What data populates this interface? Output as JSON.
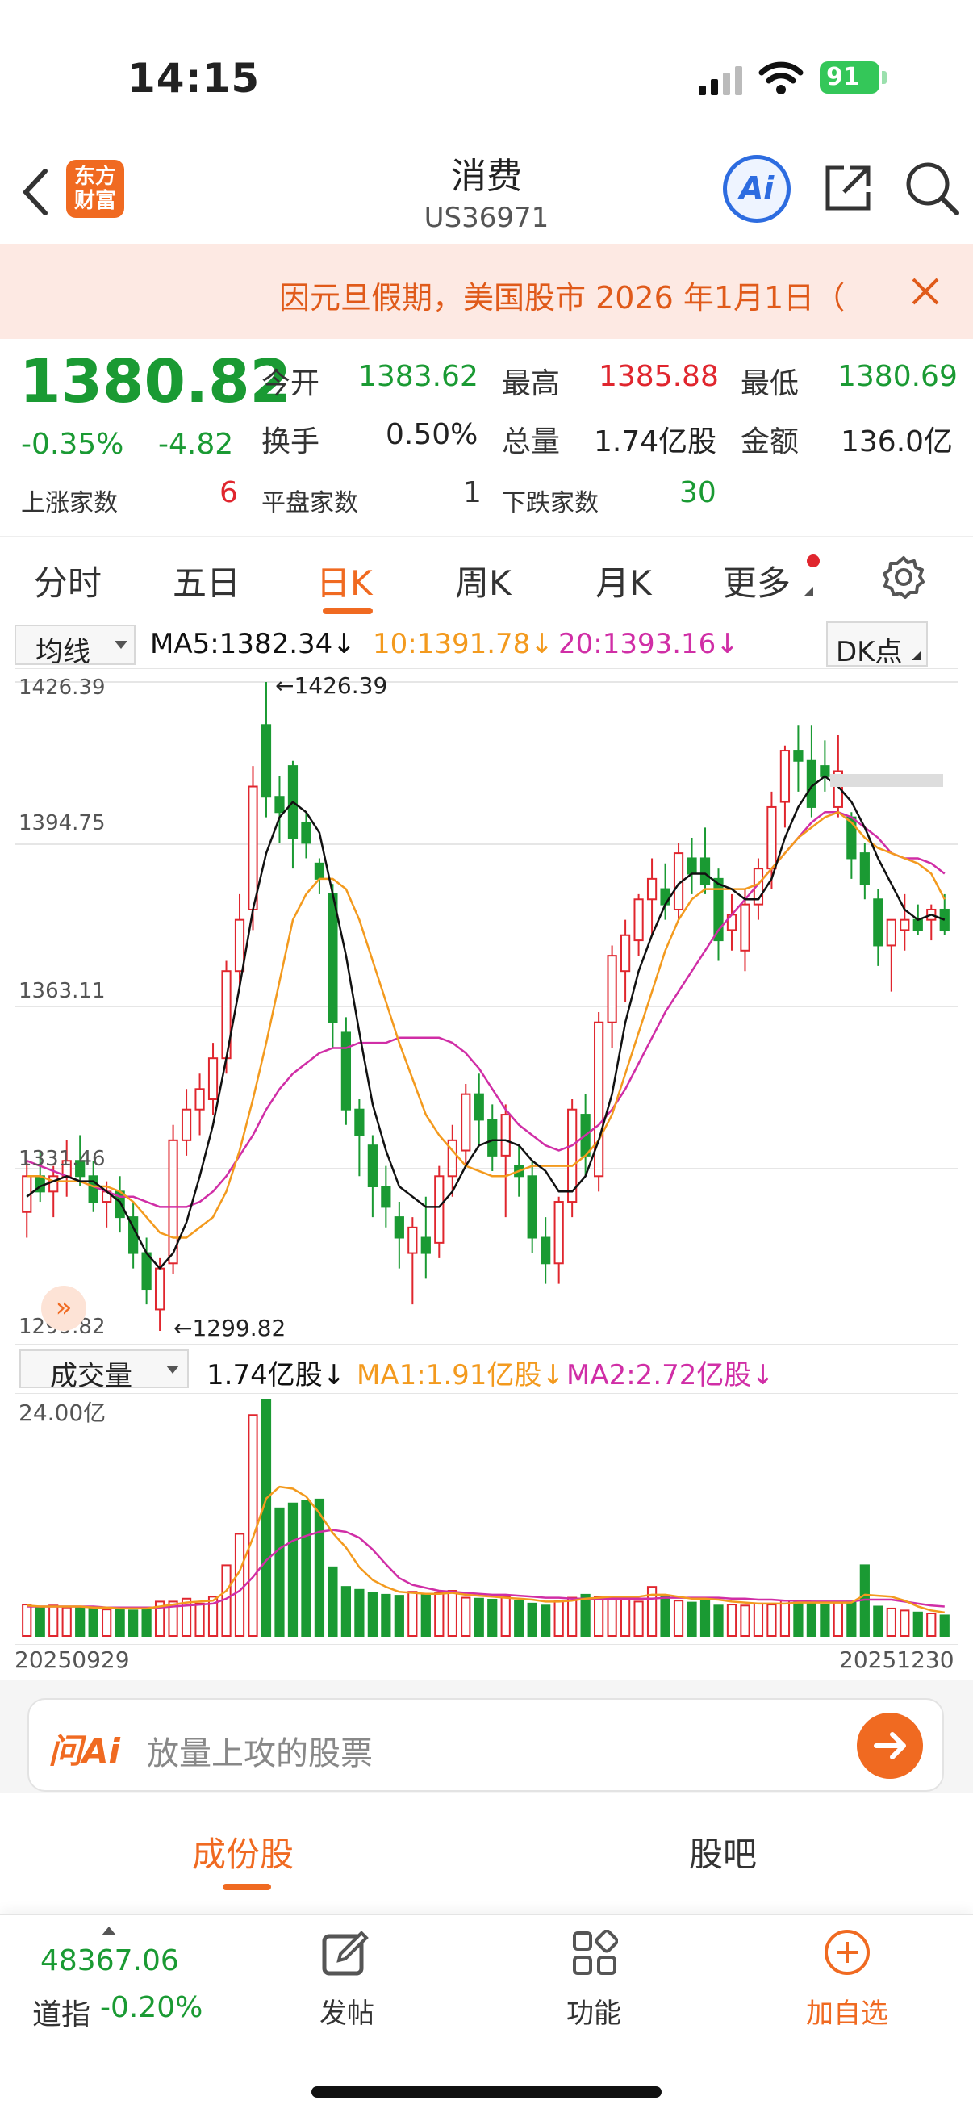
{
  "status_bar": {
    "time": "14:15",
    "battery": "91"
  },
  "nav": {
    "logo_line1": "东方",
    "logo_line2": "财富",
    "title": "消费",
    "subtitle": "US36971",
    "ai_label": "Ai"
  },
  "notice": {
    "text": "因元旦假期，美国股市 2026 年1月1日（"
  },
  "quote": {
    "price": "1380.82",
    "change_pct": "-0.35%",
    "change": "-4.82",
    "open_label": "今开",
    "open": "1383.62",
    "high_label": "最高",
    "high": "1385.88",
    "low_label": "最低",
    "low": "1380.69",
    "turnover_label": "换手",
    "turnover": "0.50%",
    "volume_label": "总量",
    "volume": "1.74亿股",
    "amount_label": "金额",
    "amount": "136.0亿",
    "up_label": "上涨家数",
    "up": "6",
    "flat_label": "平盘家数",
    "flat": "1",
    "down_label": "下跌家数",
    "down": "30"
  },
  "tabs": [
    "分时",
    "五日",
    "日K",
    "周K",
    "月K",
    "更多"
  ],
  "active_tab": "日K",
  "kline_header": {
    "indicator": "均线",
    "ma5": "MA5:1382.34↓",
    "ma10": "10:1391.78↓",
    "ma20": "20:1393.16↓",
    "dk": "DK点"
  },
  "volume_header": {
    "indicator": "成交量",
    "vol": "1.74亿股↓",
    "ma1": "MA1:1.91亿股↓",
    "ma2": "MA2:2.72亿股↓",
    "scale": "24.00亿"
  },
  "dates": {
    "start": "20250929",
    "end": "20251230"
  },
  "colors": {
    "up": "#e0262e",
    "down": "#1a9a33",
    "ma5": "#111111",
    "ma10": "#f39a1e",
    "ma20": "#d02ea6",
    "accent": "#f06a21"
  },
  "chart_data": {
    "type": "candlestick",
    "y_ticks": [
      "1426.39",
      "1394.75",
      "1363.11",
      "1331.46",
      "1299.82"
    ],
    "ylim": [
      1299.82,
      1426.39
    ],
    "annotations": {
      "max": "1426.39",
      "min": "1299.82"
    },
    "x_range": [
      "20250929",
      "20251230"
    ],
    "candles": [
      [
        1323,
        1333,
        1318,
        1330
      ],
      [
        1330,
        1335,
        1325,
        1327
      ],
      [
        1327,
        1332,
        1322,
        1330
      ],
      [
        1330,
        1337,
        1326,
        1333
      ],
      [
        1333,
        1338,
        1328,
        1330
      ],
      [
        1330,
        1333,
        1323,
        1325
      ],
      [
        1325,
        1329,
        1320,
        1327
      ],
      [
        1327,
        1330,
        1319,
        1322
      ],
      [
        1322,
        1325,
        1312,
        1315
      ],
      [
        1315,
        1318,
        1305,
        1308
      ],
      [
        1304,
        1314,
        1299.82,
        1312
      ],
      [
        1313,
        1340,
        1311,
        1337
      ],
      [
        1337,
        1347,
        1334,
        1343
      ],
      [
        1343,
        1350,
        1338,
        1347
      ],
      [
        1345,
        1356,
        1342,
        1353
      ],
      [
        1353,
        1372,
        1350,
        1370
      ],
      [
        1370,
        1385,
        1366,
        1380
      ],
      [
        1382,
        1410,
        1378,
        1406
      ],
      [
        1418,
        1426.39,
        1400,
        1404
      ],
      [
        1404,
        1408,
        1395,
        1401
      ],
      [
        1410,
        1411,
        1390,
        1396
      ],
      [
        1399,
        1401,
        1392,
        1395
      ],
      [
        1391,
        1392,
        1385,
        1388
      ],
      [
        1385,
        1387,
        1355,
        1360
      ],
      [
        1358,
        1361,
        1340,
        1343
      ],
      [
        1343,
        1345,
        1330,
        1338
      ],
      [
        1336,
        1338,
        1322,
        1328
      ],
      [
        1328,
        1332,
        1320,
        1324
      ],
      [
        1322,
        1325,
        1312,
        1318
      ],
      [
        1315,
        1322,
        1305,
        1320
      ],
      [
        1318,
        1326,
        1310,
        1315
      ],
      [
        1317,
        1332,
        1314,
        1330
      ],
      [
        1330,
        1340,
        1326,
        1337
      ],
      [
        1335,
        1348,
        1332,
        1346
      ],
      [
        1346,
        1350,
        1336,
        1341
      ],
      [
        1341,
        1344,
        1331,
        1334
      ],
      [
        1334,
        1344,
        1322,
        1342
      ],
      [
        1332,
        1336,
        1326,
        1330
      ],
      [
        1330,
        1333,
        1315,
        1318
      ],
      [
        1318,
        1322,
        1309,
        1313
      ],
      [
        1313,
        1326,
        1309,
        1325
      ],
      [
        1325,
        1345,
        1322,
        1343
      ],
      [
        1342,
        1346,
        1330,
        1334
      ],
      [
        1330,
        1362,
        1327,
        1360
      ],
      [
        1360,
        1375,
        1355,
        1373
      ],
      [
        1370,
        1380,
        1364,
        1377
      ],
      [
        1376,
        1385,
        1373,
        1384
      ],
      [
        1384,
        1392,
        1377,
        1388
      ],
      [
        1386,
        1391,
        1380,
        1383
      ],
      [
        1382,
        1395,
        1380,
        1393
      ],
      [
        1392,
        1396,
        1385,
        1389
      ],
      [
        1392,
        1398,
        1385,
        1387
      ],
      [
        1388,
        1390,
        1372,
        1376
      ],
      [
        1378,
        1385,
        1374,
        1381
      ],
      [
        1374,
        1386,
        1370,
        1383
      ],
      [
        1383,
        1392,
        1380,
        1390
      ],
      [
        1390,
        1405,
        1386,
        1402
      ],
      [
        1403,
        1414,
        1398,
        1413
      ],
      [
        1413,
        1418,
        1405,
        1411
      ],
      [
        1411,
        1418,
        1400,
        1402
      ],
      [
        1410,
        1415,
        1405,
        1408
      ],
      [
        1402,
        1416,
        1400,
        1409
      ],
      [
        1400,
        1401,
        1388,
        1392
      ],
      [
        1393,
        1395,
        1384,
        1387
      ],
      [
        1384,
        1386,
        1371,
        1375
      ],
      [
        1375,
        1378,
        1366,
        1380
      ],
      [
        1378,
        1385,
        1374,
        1380
      ],
      [
        1380,
        1383,
        1377,
        1378
      ],
      [
        1380,
        1383,
        1376,
        1382
      ],
      [
        1382,
        1385,
        1377,
        1378
      ]
    ],
    "volume_ylim": [
      0,
      24
    ],
    "volumes": [
      3.2,
      3.0,
      3.1,
      2.9,
      3.0,
      2.8,
      2.7,
      2.8,
      2.6,
      2.9,
      3.5,
      3.5,
      3.8,
      3.3,
      4.0,
      7.2,
      10.4,
      22.5,
      24,
      13.0,
      13.5,
      13.8,
      13.9,
      7.0,
      5.0,
      4.7,
      4.4,
      4.2,
      4.1,
      4.5,
      4.3,
      4.4,
      4.6,
      3.9,
      3.8,
      3.7,
      4.0,
      3.6,
      3.3,
      3.1,
      3.6,
      3.9,
      4.2,
      4.0,
      3.9,
      3.8,
      3.5,
      5.0,
      4.0,
      3.6,
      3.4,
      3.9,
      3.1,
      3.2,
      3.1,
      3.3,
      3.2,
      3.6,
      3.4,
      3.5,
      3.2,
      3.4,
      3.5,
      7.2,
      3.0,
      2.8,
      2.6,
      2.4,
      2.3,
      2.1
    ],
    "ma5": [
      1326,
      1328,
      1329,
      1330,
      1329,
      1329,
      1327,
      1325,
      1320,
      1315,
      1312,
      1315,
      1321,
      1330,
      1340,
      1353,
      1367,
      1382,
      1393,
      1400,
      1403,
      1401,
      1397,
      1385,
      1373,
      1358,
      1344,
      1335,
      1328,
      1326,
      1324,
      1324,
      1327,
      1332,
      1336,
      1337,
      1337,
      1336,
      1333,
      1331,
      1327,
      1327,
      1330,
      1337,
      1346,
      1360,
      1370,
      1377,
      1383,
      1387,
      1389,
      1389,
      1387,
      1386,
      1384,
      1384,
      1388,
      1396,
      1402,
      1406,
      1408,
      1406,
      1403,
      1398,
      1392,
      1387,
      1382,
      1380,
      1381,
      1380
    ],
    "ma10": [
      1330,
      1330,
      1329,
      1329,
      1329,
      1328,
      1328,
      1327,
      1325,
      1322,
      1319,
      1318,
      1318,
      1320,
      1322,
      1327,
      1335,
      1345,
      1356,
      1368,
      1380,
      1385,
      1388,
      1388,
      1386,
      1380,
      1372,
      1364,
      1356,
      1349,
      1342,
      1338,
      1335,
      1332,
      1331,
      1330,
      1330,
      1331,
      1332,
      1332,
      1332,
      1332,
      1334,
      1337,
      1342,
      1350,
      1358,
      1366,
      1374,
      1380,
      1384,
      1386,
      1386,
      1386,
      1386,
      1387,
      1390,
      1393,
      1396,
      1398,
      1400,
      1401,
      1399,
      1396,
      1394,
      1393,
      1392,
      1391,
      1389,
      1384
    ],
    "ma20": [
      1333,
      1332,
      1331,
      1330,
      1329,
      1328,
      1327,
      1326,
      1326,
      1325,
      1324,
      1324,
      1324,
      1325,
      1327,
      1330,
      1334,
      1338,
      1343,
      1347,
      1350,
      1352,
      1354,
      1355,
      1355,
      1356,
      1356,
      1356,
      1357,
      1357,
      1357,
      1357,
      1356,
      1354,
      1351,
      1347,
      1343,
      1340,
      1338,
      1336,
      1335,
      1336,
      1338,
      1340,
      1343,
      1347,
      1352,
      1357,
      1362,
      1366,
      1370,
      1374,
      1378,
      1381,
      1384,
      1387,
      1390,
      1393,
      1396,
      1399,
      1401,
      1401,
      1400,
      1398,
      1396,
      1393,
      1392,
      1392,
      1391,
      1389
    ],
    "vol_ma1": [
      3.1,
      3.0,
      3.0,
      3.0,
      3.0,
      2.9,
      2.9,
      2.8,
      2.8,
      2.8,
      3.0,
      3.2,
      3.4,
      3.5,
      3.6,
      4.6,
      6.6,
      10.0,
      14.0,
      15.2,
      15.0,
      14.2,
      12.5,
      10.5,
      9.0,
      7.0,
      5.7,
      5.0,
      4.5,
      4.4,
      4.3,
      4.3,
      4.4,
      4.2,
      4.1,
      4.0,
      3.9,
      3.8,
      3.7,
      3.5,
      3.5,
      3.6,
      3.8,
      3.9,
      4.0,
      4.0,
      4.0,
      4.2,
      4.2,
      4.0,
      3.8,
      3.8,
      3.7,
      3.5,
      3.4,
      3.3,
      3.3,
      3.3,
      3.4,
      3.4,
      3.4,
      3.4,
      3.4,
      4.2,
      4.1,
      4.0,
      3.6,
      3.0,
      2.6,
      2.4
    ],
    "vol_ma2": [
      3.0,
      3.0,
      3.0,
      3.0,
      3.0,
      3.0,
      2.9,
      2.9,
      2.9,
      2.9,
      2.9,
      3.0,
      3.1,
      3.2,
      3.3,
      3.8,
      4.6,
      6.0,
      7.7,
      8.9,
      9.7,
      10.2,
      10.6,
      10.8,
      10.6,
      10.0,
      8.8,
      7.3,
      5.9,
      5.2,
      4.9,
      4.6,
      4.5,
      4.4,
      4.3,
      4.2,
      4.2,
      4.1,
      4.0,
      3.9,
      3.9,
      3.8,
      3.8,
      3.8,
      3.8,
      3.8,
      3.8,
      3.8,
      3.9,
      3.9,
      3.9,
      3.9,
      3.9,
      3.8,
      3.8,
      3.7,
      3.7,
      3.6,
      3.6,
      3.5,
      3.5,
      3.5,
      3.5,
      3.7,
      3.7,
      3.7,
      3.5,
      3.3,
      3.1,
      3.0
    ]
  },
  "ask_box": {
    "brand": "问Ai",
    "placeholder": "放量上攻的股票"
  },
  "bottom_tabs": [
    "成份股",
    "股吧"
  ],
  "bottom_nav": {
    "dow_value": "48367.06",
    "dow_label": "道指",
    "dow_change": "-0.20%",
    "post": "发帖",
    "functions": "功能",
    "add_watch": "加自选"
  }
}
